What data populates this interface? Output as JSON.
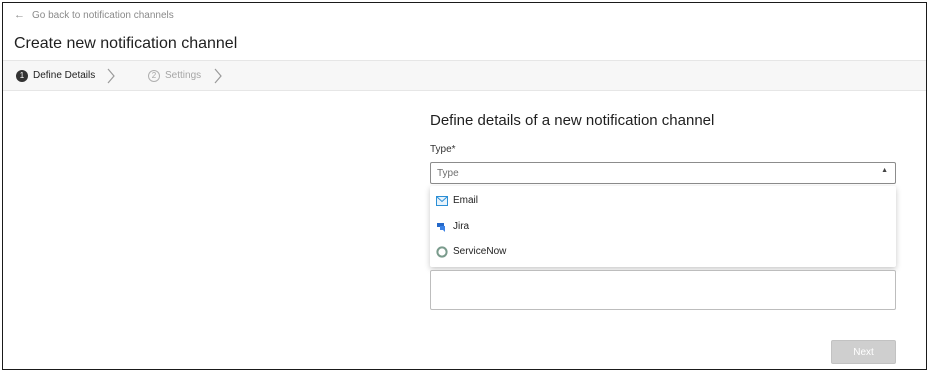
{
  "header": {
    "back_link": "Go back to notification channels",
    "title": "Create new notification channel"
  },
  "stepper": {
    "steps": [
      {
        "number": "1",
        "label": "Define Details",
        "state": "active"
      },
      {
        "number": "2",
        "label": "Settings",
        "state": "inactive"
      }
    ]
  },
  "form": {
    "heading": "Define details of a new notification channel",
    "type_label": "Type*",
    "type_placeholder": "Type",
    "type_options": [
      {
        "label": "Email",
        "icon": "envelope-icon"
      },
      {
        "label": "Jira",
        "icon": "jira-icon"
      },
      {
        "label": "ServiceNow",
        "icon": "servicenow-icon"
      }
    ],
    "next_label": "Next"
  },
  "colors": {
    "email_icon": "#2b8fd6",
    "jira_icon": "#2468c9",
    "servicenow_icon": "#7a9b8c",
    "disabled_button": "#cfcfcf"
  }
}
